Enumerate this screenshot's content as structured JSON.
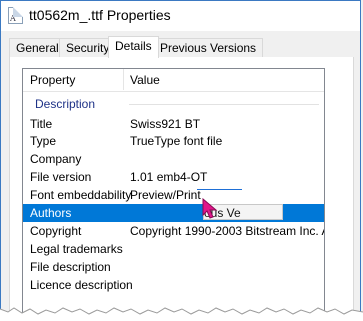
{
  "window": {
    "title": "tt0562m_.ttf Properties",
    "icon": "font-file-icon"
  },
  "tabs": [
    {
      "label": "General",
      "active": false
    },
    {
      "label": "Security",
      "active": false
    },
    {
      "label": "Details",
      "active": true
    },
    {
      "label": "Previous Versions",
      "active": false
    }
  ],
  "table": {
    "columns": [
      "Property",
      "Value"
    ],
    "group": "Description",
    "rows": [
      {
        "property": "Title",
        "value": "Swiss921 BT"
      },
      {
        "property": "Type",
        "value": "TrueType font file"
      },
      {
        "property": "Company",
        "value": ""
      },
      {
        "property": "File version",
        "value": "1.01 emb4-OT"
      },
      {
        "property": "Font embeddability",
        "value": "Preview/Print"
      },
      {
        "property": "Authors",
        "value": "",
        "selected": true
      },
      {
        "property": "Copyright",
        "value": "Copyright 1990-2003 Bitstream Inc. A..."
      },
      {
        "property": "Legal trademarks",
        "value": ""
      },
      {
        "property": "File description",
        "value": ""
      },
      {
        "property": "Licence description",
        "value": ""
      }
    ]
  },
  "tooltip": {
    "text": "ous Ve"
  },
  "colors": {
    "selection": "#0078d7",
    "group_header": "#1e3287",
    "cursor": "#e0168a"
  }
}
